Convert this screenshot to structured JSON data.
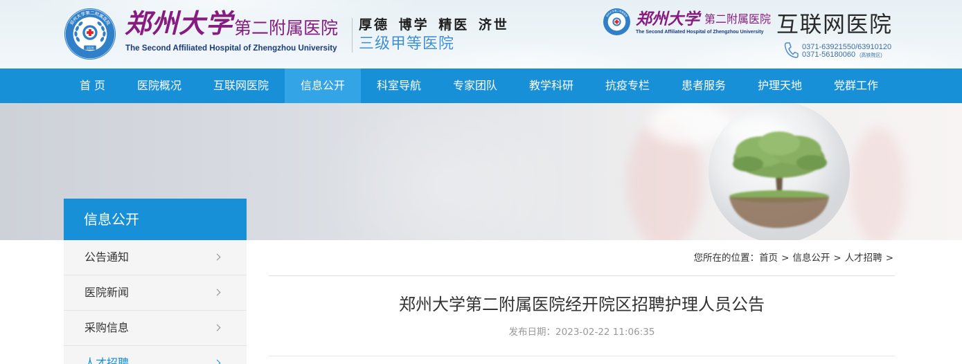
{
  "header": {
    "logo_left": {
      "seal_ring_text": "郑州大学第二附属医院",
      "seal_year": "1928",
      "title_cn_main": "郑州大学",
      "title_cn_sub": "第二附属医院",
      "title_en": "The Second Affiliated Hospital of Zhengzhou University"
    },
    "motto": "厚德 博学 精医 济世",
    "grade": "三级甲等医院",
    "logo_right": {
      "seal_ring_text": "郑州大学第二附属医院",
      "title_cn_main": "郑州大学",
      "title_cn_sub": "第二附属医院",
      "title_en": "The Second Affiliated Hospital of Zhengzhou University"
    },
    "service_name": "互联网医院",
    "phone_icon": "phone-icon",
    "phone_line_1": "0371-63921550/63910120",
    "phone_line_2": "0371-56180060",
    "phone_line_2_note": "(高铁院区)"
  },
  "nav": {
    "items": [
      "首 页",
      "医院概况",
      "互联网医院",
      "信息公开",
      "科室导航",
      "专家团队",
      "教学科研",
      "抗疫专栏",
      "患者服务",
      "护理天地",
      "党群工作"
    ],
    "active_index": 3
  },
  "sidebar": {
    "title": "信息公开",
    "items": [
      "公告通知",
      "医院新闻",
      "采购信息",
      "人才招聘"
    ],
    "active_index": 3,
    "item_icon": "chevron-right-icon"
  },
  "breadcrumb": {
    "label": "您所在的位置：",
    "separator": ">",
    "path": [
      "首页",
      "信息公开",
      "人才招聘"
    ]
  },
  "article": {
    "title": "郑州大学第二附属医院经开院区招聘护理人员公告",
    "date_label": "发布日期：",
    "date": "2023-02-22 11:06:35"
  },
  "colors": {
    "nav_bg": "#1890d7",
    "nav_active_bg": "#33a4e6",
    "brand_purple": "#861c80",
    "brand_navy": "#1b3b7c",
    "sidebar_title_bg": "#1890d7",
    "link_active": "#1890d7",
    "seal_blue": "#2f7fc9",
    "cross_red": "#e0262b"
  }
}
